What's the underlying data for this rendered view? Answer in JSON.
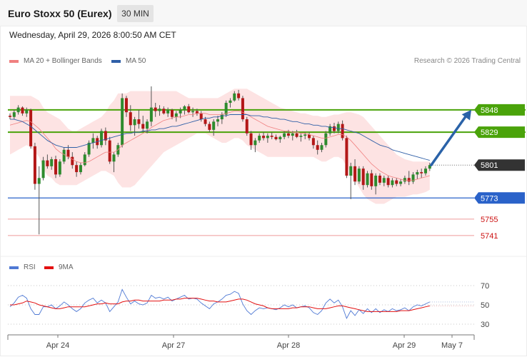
{
  "header": {
    "title": "Euro Stoxx 50 (Eurex)",
    "timeframe": "30 MIN",
    "datetime": "Wednesday, April 29, 2026 8:00:50 AM CET"
  },
  "legend": {
    "ma20": {
      "label": "MA 20 + Bollinger Bands",
      "color": "#f08080"
    },
    "ma50": {
      "label": "MA 50",
      "color": "#2f5fa7"
    },
    "rsi": {
      "label": "RSI",
      "color": "#4f79d4"
    },
    "rsi_ma": {
      "label": "9MA",
      "color": "#e31010"
    }
  },
  "credit": "Research © 2026 Trading Central",
  "colors": {
    "bull": "#2e8b2e",
    "bear": "#b31717",
    "band": "#fde3e3",
    "resistance": "#4aa30a",
    "current": "#333333",
    "support1": "#2a62c9",
    "support2": "#ef9a9a",
    "arrow": "#2a62a8"
  },
  "chart_data": [
    {
      "type": "candlestick",
      "x_labels": [
        "Apr 24",
        "Apr 27",
        "Apr 28",
        "Apr 29",
        "May 7"
      ],
      "ylim": [
        5730,
        5868
      ],
      "levels": [
        {
          "value": 5848,
          "label": "5848",
          "kind": "resistance"
        },
        {
          "value": 5829,
          "label": "5829",
          "kind": "resistance"
        },
        {
          "value": 5801,
          "label": "5801",
          "kind": "current"
        },
        {
          "value": 5773,
          "label": "5773",
          "kind": "support"
        },
        {
          "value": 5755,
          "label": "5755",
          "kind": "minor"
        },
        {
          "value": 5741,
          "label": "5741",
          "kind": "minor"
        }
      ],
      "candles": [
        [
          5843,
          5845,
          5840,
          5842
        ],
        [
          5842,
          5848,
          5840,
          5846
        ],
        [
          5846,
          5852,
          5844,
          5850
        ],
        [
          5850,
          5851,
          5843,
          5845
        ],
        [
          5845,
          5850,
          5842,
          5848
        ],
        [
          5848,
          5849,
          5815,
          5817
        ],
        [
          5817,
          5820,
          5780,
          5785
        ],
        [
          5785,
          5800,
          5742,
          5790
        ],
        [
          5790,
          5808,
          5788,
          5805
        ],
        [
          5805,
          5810,
          5798,
          5800
        ],
        [
          5800,
          5808,
          5797,
          5806
        ],
        [
          5806,
          5809,
          5790,
          5793
        ],
        [
          5793,
          5806,
          5791,
          5804
        ],
        [
          5804,
          5816,
          5802,
          5814
        ],
        [
          5814,
          5818,
          5806,
          5808
        ],
        [
          5808,
          5812,
          5798,
          5801
        ],
        [
          5801,
          5804,
          5791,
          5795
        ],
        [
          5795,
          5803,
          5793,
          5801
        ],
        [
          5801,
          5812,
          5800,
          5810
        ],
        [
          5810,
          5822,
          5808,
          5820
        ],
        [
          5820,
          5828,
          5815,
          5824
        ],
        [
          5824,
          5826,
          5815,
          5818
        ],
        [
          5818,
          5832,
          5816,
          5830
        ],
        [
          5830,
          5833,
          5818,
          5822
        ],
        [
          5822,
          5825,
          5802,
          5804
        ],
        [
          5804,
          5812,
          5795,
          5810
        ],
        [
          5810,
          5820,
          5808,
          5818
        ],
        [
          5818,
          5862,
          5816,
          5858
        ],
        [
          5858,
          5860,
          5842,
          5846
        ],
        [
          5846,
          5852,
          5830,
          5835
        ],
        [
          5835,
          5842,
          5826,
          5840
        ],
        [
          5840,
          5848,
          5832,
          5836
        ],
        [
          5836,
          5843,
          5829,
          5832
        ],
        [
          5832,
          5840,
          5828,
          5838
        ],
        [
          5838,
          5868,
          5834,
          5850
        ],
        [
          5850,
          5854,
          5842,
          5847
        ],
        [
          5847,
          5852,
          5843,
          5849
        ],
        [
          5849,
          5851,
          5844,
          5845
        ],
        [
          5845,
          5850,
          5842,
          5848
        ],
        [
          5848,
          5849,
          5840,
          5842
        ],
        [
          5842,
          5847,
          5838,
          5845
        ],
        [
          5845,
          5850,
          5841,
          5848
        ],
        [
          5848,
          5852,
          5844,
          5851
        ],
        [
          5851,
          5853,
          5845,
          5846
        ],
        [
          5846,
          5850,
          5842,
          5847
        ],
        [
          5847,
          5849,
          5843,
          5845
        ],
        [
          5845,
          5847,
          5838,
          5840
        ],
        [
          5840,
          5842,
          5834,
          5836
        ],
        [
          5836,
          5838,
          5829,
          5831
        ],
        [
          5831,
          5840,
          5826,
          5838
        ],
        [
          5838,
          5843,
          5834,
          5840
        ],
        [
          5840,
          5846,
          5836,
          5844
        ],
        [
          5844,
          5856,
          5842,
          5854
        ],
        [
          5854,
          5858,
          5850,
          5856
        ],
        [
          5856,
          5864,
          5855,
          5862
        ],
        [
          5862,
          5865,
          5856,
          5858
        ],
        [
          5858,
          5860,
          5838,
          5840
        ],
        [
          5840,
          5842,
          5826,
          5828
        ],
        [
          5828,
          5830,
          5814,
          5818
        ],
        [
          5818,
          5824,
          5812,
          5822
        ],
        [
          5822,
          5828,
          5820,
          5826
        ],
        [
          5826,
          5829,
          5822,
          5824
        ],
        [
          5824,
          5828,
          5820,
          5826
        ],
        [
          5826,
          5829,
          5823,
          5825
        ],
        [
          5825,
          5827,
          5822,
          5823
        ],
        [
          5823,
          5826,
          5820,
          5825
        ],
        [
          5825,
          5830,
          5823,
          5828
        ],
        [
          5828,
          5831,
          5824,
          5826
        ],
        [
          5826,
          5830,
          5822,
          5828
        ],
        [
          5828,
          5831,
          5824,
          5825
        ],
        [
          5825,
          5828,
          5821,
          5826
        ],
        [
          5826,
          5829,
          5823,
          5827
        ],
        [
          5827,
          5829,
          5822,
          5824
        ],
        [
          5824,
          5826,
          5815,
          5818
        ],
        [
          5818,
          5822,
          5810,
          5814
        ],
        [
          5814,
          5820,
          5812,
          5818
        ],
        [
          5818,
          5830,
          5816,
          5828
        ],
        [
          5828,
          5836,
          5826,
          5834
        ],
        [
          5834,
          5837,
          5828,
          5830
        ],
        [
          5830,
          5838,
          5828,
          5836
        ],
        [
          5836,
          5839,
          5822,
          5824
        ],
        [
          5824,
          5826,
          5790,
          5792
        ],
        [
          5792,
          5803,
          5772,
          5800
        ],
        [
          5800,
          5806,
          5784,
          5787
        ],
        [
          5787,
          5800,
          5785,
          5798
        ],
        [
          5798,
          5800,
          5780,
          5784
        ],
        [
          5784,
          5796,
          5782,
          5794
        ],
        [
          5794,
          5797,
          5780,
          5783
        ],
        [
          5783,
          5794,
          5776,
          5792
        ],
        [
          5792,
          5794,
          5784,
          5786
        ],
        [
          5786,
          5792,
          5783,
          5790
        ],
        [
          5790,
          5792,
          5782,
          5784
        ],
        [
          5784,
          5790,
          5782,
          5788
        ],
        [
          5788,
          5790,
          5783,
          5785
        ],
        [
          5785,
          5789,
          5783,
          5787
        ],
        [
          5787,
          5792,
          5785,
          5790
        ],
        [
          5790,
          5796,
          5784,
          5787
        ],
        [
          5787,
          5795,
          5785,
          5793
        ],
        [
          5793,
          5797,
          5789,
          5795
        ],
        [
          5795,
          5798,
          5790,
          5794
        ],
        [
          5794,
          5800,
          5792,
          5798
        ],
        [
          5798,
          5803,
          5796,
          5801
        ]
      ],
      "ma20": [
        5835,
        5836,
        5837,
        5838,
        5839,
        5838,
        5835,
        5832,
        5828,
        5824,
        5820,
        5815,
        5812,
        5810,
        5808,
        5806,
        5804,
        5803,
        5803,
        5804,
        5806,
        5808,
        5810,
        5812,
        5812,
        5812,
        5814,
        5818,
        5820,
        5822,
        5824,
        5826,
        5828,
        5830,
        5833,
        5835,
        5837,
        5839,
        5840,
        5841,
        5842,
        5842,
        5843,
        5844,
        5844,
        5845,
        5845,
        5845,
        5844,
        5844,
        5844,
        5844,
        5845,
        5846,
        5847,
        5847,
        5846,
        5844,
        5842,
        5840,
        5838,
        5836,
        5834,
        5833,
        5832,
        5831,
        5830,
        5830,
        5829,
        5829,
        5828,
        5828,
        5827,
        5826,
        5825,
        5824,
        5824,
        5825,
        5826,
        5827,
        5827,
        5825,
        5822,
        5818,
        5814,
        5810,
        5806,
        5802,
        5799,
        5796,
        5794,
        5792,
        5791,
        5790,
        5789,
        5788,
        5788,
        5788,
        5789,
        5790,
        5791,
        5792
      ],
      "bb_upper": [
        5860,
        5860,
        5860,
        5860,
        5860,
        5860,
        5858,
        5856,
        5850,
        5846,
        5844,
        5842,
        5840,
        5836,
        5832,
        5830,
        5830,
        5832,
        5834,
        5836,
        5838,
        5840,
        5842,
        5846,
        5852,
        5856,
        5862,
        5862,
        5862,
        5864,
        5864,
        5864,
        5864,
        5864,
        5864,
        5864,
        5864,
        5864,
        5864,
        5864,
        5864,
        5862,
        5860,
        5858,
        5858,
        5858,
        5858,
        5858,
        5858,
        5858,
        5858,
        5860,
        5862,
        5864,
        5866,
        5866,
        5866,
        5866,
        5864,
        5862,
        5860,
        5858,
        5856,
        5854,
        5852,
        5850,
        5849,
        5848,
        5847,
        5846,
        5845,
        5845,
        5844,
        5843,
        5843,
        5842,
        5842,
        5843,
        5844,
        5844,
        5845,
        5846,
        5846,
        5845,
        5844,
        5842,
        5838,
        5834,
        5830,
        5826,
        5822,
        5818,
        5814,
        5810,
        5808,
        5806,
        5805,
        5804,
        5804,
        5804,
        5804,
        5804
      ],
      "bb_lower": [
        5810,
        5812,
        5814,
        5816,
        5818,
        5816,
        5812,
        5808,
        5798,
        5792,
        5790,
        5786,
        5784,
        5784,
        5784,
        5784,
        5784,
        5786,
        5788,
        5790,
        5792,
        5794,
        5796,
        5796,
        5794,
        5792,
        5786,
        5782,
        5782,
        5782,
        5784,
        5788,
        5792,
        5796,
        5800,
        5804,
        5808,
        5812,
        5814,
        5816,
        5818,
        5820,
        5822,
        5824,
        5826,
        5828,
        5828,
        5828,
        5826,
        5824,
        5822,
        5820,
        5820,
        5822,
        5824,
        5824,
        5822,
        5818,
        5816,
        5814,
        5812,
        5810,
        5808,
        5808,
        5808,
        5808,
        5808,
        5808,
        5808,
        5808,
        5808,
        5808,
        5808,
        5808,
        5806,
        5804,
        5804,
        5806,
        5808,
        5808,
        5806,
        5800,
        5794,
        5788,
        5782,
        5776,
        5772,
        5770,
        5768,
        5768,
        5768,
        5770,
        5772,
        5774,
        5774,
        5774,
        5775,
        5776,
        5776,
        5777,
        5778,
        5780
      ],
      "ma50": [
        5840,
        5840,
        5839,
        5838,
        5836,
        5834,
        5831,
        5828,
        5825,
        5822,
        5820,
        5818,
        5817,
        5816,
        5816,
        5816,
        5816,
        5817,
        5818,
        5819,
        5820,
        5821,
        5822,
        5823,
        5824,
        5825,
        5826,
        5827,
        5828,
        5828,
        5829,
        5829,
        5830,
        5830,
        5831,
        5831,
        5832,
        5832,
        5833,
        5834,
        5834,
        5835,
        5836,
        5837,
        5838,
        5839,
        5840,
        5841,
        5841,
        5842,
        5842,
        5843,
        5843,
        5844,
        5844,
        5844,
        5844,
        5844,
        5843,
        5843,
        5843,
        5842,
        5842,
        5841,
        5841,
        5840,
        5840,
        5839,
        5838,
        5838,
        5837,
        5836,
        5836,
        5835,
        5835,
        5834,
        5834,
        5833,
        5833,
        5832,
        5832,
        5831,
        5830,
        5829,
        5828,
        5826,
        5824,
        5822,
        5820,
        5818,
        5817,
        5816,
        5814,
        5813,
        5812,
        5811,
        5810,
        5809,
        5808,
        5807,
        5806,
        5805
      ],
      "forecast": {
        "from": 5801,
        "to": 5848
      }
    },
    {
      "type": "line",
      "name": "RSI",
      "ylim": [
        20,
        80
      ],
      "ticks": [
        70,
        50,
        30
      ],
      "series": [
        {
          "name": "RSI",
          "values": [
            48,
            52,
            58,
            60,
            57,
            46,
            40,
            40,
            48,
            48,
            50,
            46,
            49,
            53,
            50,
            46,
            43,
            46,
            52,
            55,
            57,
            52,
            55,
            52,
            43,
            48,
            53,
            66,
            58,
            51,
            54,
            51,
            50,
            52,
            60,
            57,
            58,
            56,
            58,
            54,
            56,
            58,
            60,
            56,
            57,
            56,
            52,
            49,
            46,
            51,
            53,
            56,
            60,
            61,
            64,
            62,
            51,
            44,
            40,
            44,
            47,
            46,
            47,
            46,
            45,
            47,
            50,
            48,
            50,
            47,
            48,
            49,
            47,
            42,
            40,
            44,
            52,
            56,
            52,
            55,
            48,
            36,
            44,
            39,
            45,
            41,
            46,
            42,
            46,
            42,
            45,
            43,
            46,
            44,
            45,
            47,
            44,
            48,
            50,
            49,
            51,
            53
          ]
        },
        {
          "name": "9MA",
          "values": [
            50,
            50,
            51,
            52,
            54,
            53,
            52,
            50,
            49,
            48,
            47,
            46,
            46,
            47,
            48,
            48,
            48,
            48,
            48,
            49,
            50,
            51,
            51,
            52,
            51,
            51,
            51,
            53,
            54,
            54,
            55,
            55,
            54,
            54,
            54,
            54,
            54,
            55,
            55,
            55,
            56,
            56,
            57,
            57,
            57,
            57,
            56,
            55,
            54,
            54,
            53,
            53,
            53,
            54,
            55,
            56,
            56,
            55,
            53,
            51,
            50,
            49,
            47,
            46,
            46,
            46,
            46,
            46,
            47,
            47,
            48,
            48,
            48,
            47,
            46,
            46,
            46,
            47,
            48,
            49,
            49,
            48,
            47,
            46,
            45,
            44,
            43,
            43,
            43,
            43,
            43,
            43,
            43,
            43,
            44,
            44,
            44,
            45,
            46,
            47,
            48,
            49
          ]
        }
      ]
    }
  ]
}
